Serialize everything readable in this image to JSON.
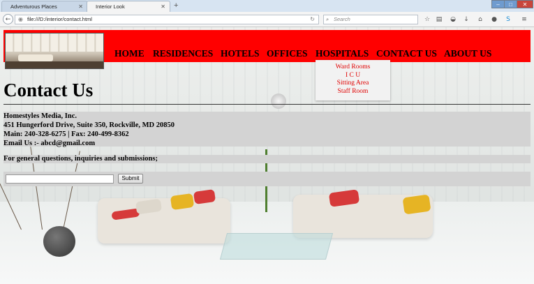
{
  "browser": {
    "tabs": [
      {
        "label": "Adventurous Places",
        "active": false
      },
      {
        "label": "Interior Look",
        "active": true
      }
    ],
    "url": "file:///D:/interior/contact.html",
    "search_placeholder": "Search"
  },
  "site": {
    "nav": [
      "HOME",
      "RESIDENCES",
      "HOTELS",
      "OFFICES",
      "HOSPITALS",
      "CONTACT US",
      "ABOUT US"
    ],
    "dropdown": [
      "Ward Rooms",
      "I C U",
      "Sitting Area",
      "Staff Room"
    ],
    "accent_color": "#ff0000",
    "dropdown_text_color": "#e00000"
  },
  "page": {
    "title": "Contact Us",
    "company": "Homestyles Media, Inc.",
    "address": "451 Hungerford Drive, Suite 350, Rockville, MD 20850",
    "phone": "Main: 240-328-6275 | Fax: 240-499-8362",
    "email": "Email Us :- abcd@gmail.com",
    "general": "For general questions, inquiries and submissions;",
    "input_value": "",
    "submit_label": "Submit"
  }
}
